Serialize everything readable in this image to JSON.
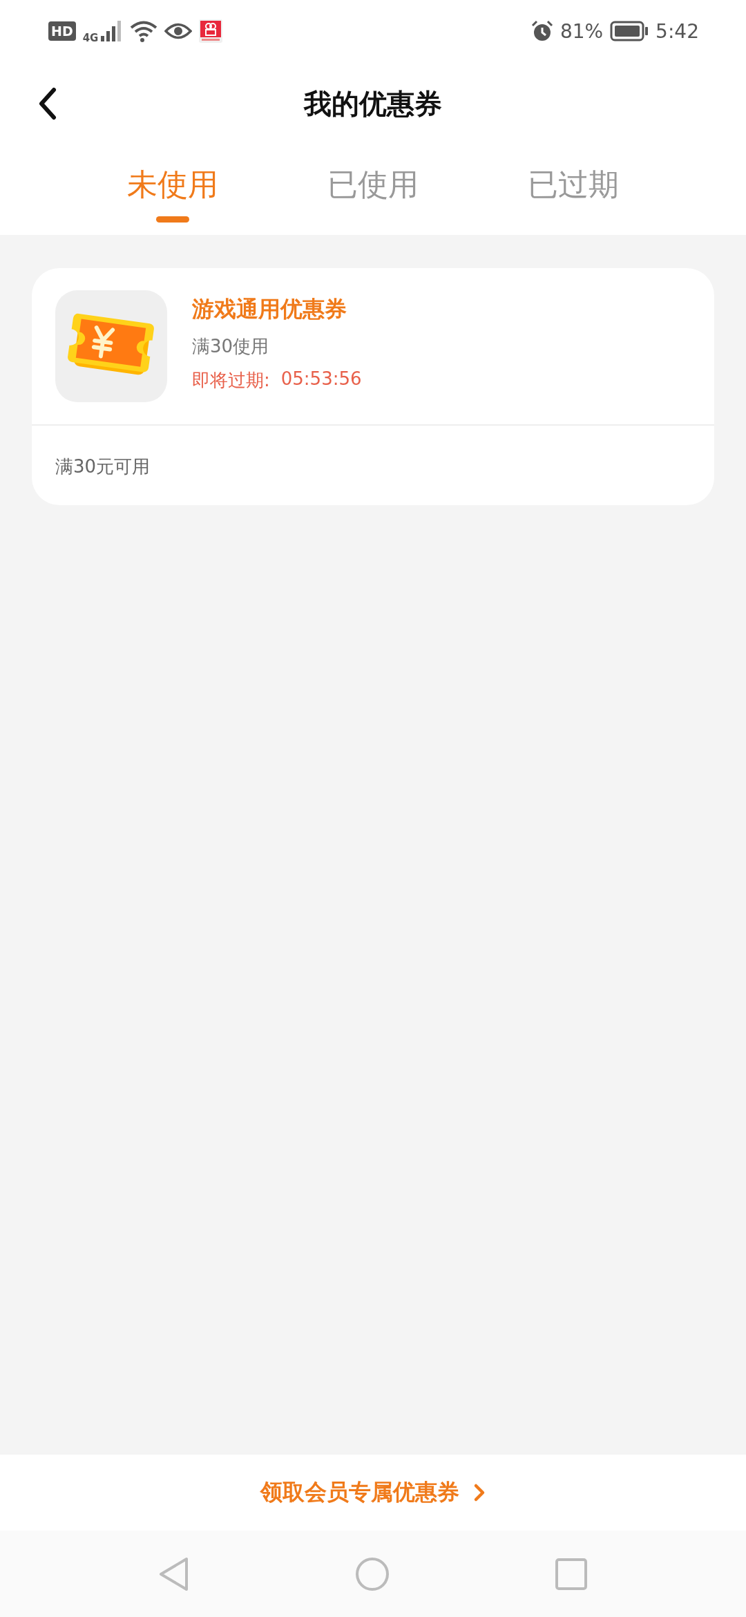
{
  "status_bar": {
    "hd": "HD",
    "network": "4G",
    "battery": "81%",
    "time": "5:42"
  },
  "header": {
    "title": "我的优惠券"
  },
  "tabs": [
    {
      "label": "未使用",
      "selected": true
    },
    {
      "label": "已使用",
      "selected": false
    },
    {
      "label": "已过期",
      "selected": false
    }
  ],
  "coupons": [
    {
      "title": "游戏通用优惠券",
      "condition": "满30使用",
      "expiry_label": "即将过期:",
      "expiry_time": "05:53:56",
      "note": "满30元可用"
    }
  ],
  "footer": {
    "link": "领取会员专属优惠券"
  }
}
